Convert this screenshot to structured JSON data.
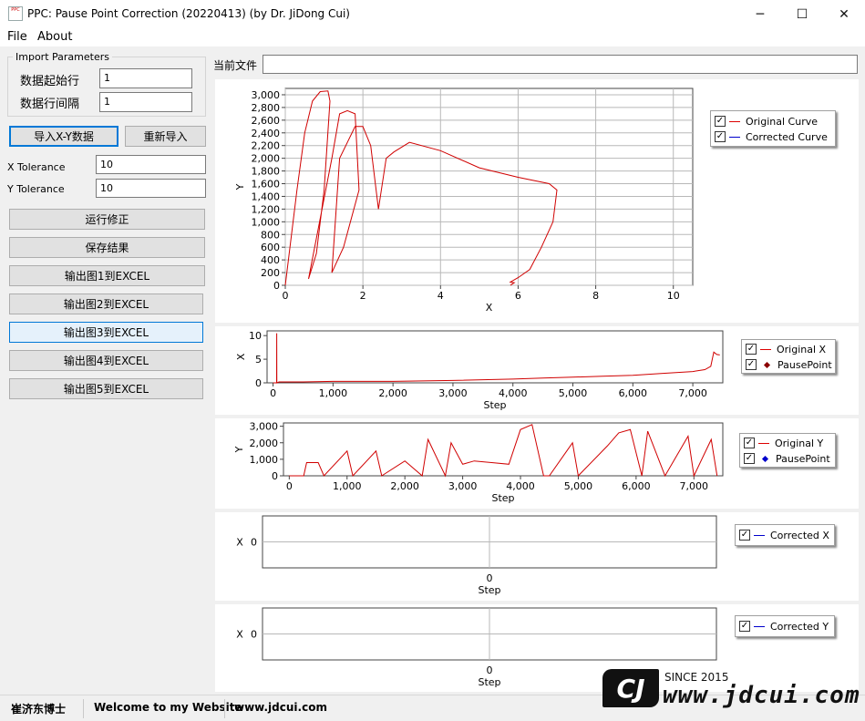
{
  "window": {
    "title": "PPC: Pause Point Correction (20220413) (by Dr. JiDong Cui)",
    "icon_text": "PPC",
    "controls": [
      "─",
      "☐",
      "✕"
    ]
  },
  "menu": {
    "items": [
      "File",
      "About"
    ]
  },
  "import_params": {
    "legend": "Import Parameters",
    "start_row_label": "数据起始行",
    "start_row_value": "1",
    "row_interval_label": "数据行间隔",
    "row_interval_value": "1"
  },
  "buttons": {
    "import_xy": "导入X-Y数据",
    "reimport": "重新导入",
    "run": "运行修正",
    "save": "保存结果",
    "export1": "输出图1到EXCEL",
    "export2": "输出图2到EXCEL",
    "export3": "输出图3到EXCEL",
    "export4": "输出图4到EXCEL",
    "export5": "输出图5到EXCEL"
  },
  "tolerance": {
    "x_label": "X Tolerance",
    "x_value": "10",
    "y_label": "Y Tolerance",
    "y_value": "10"
  },
  "current_file": {
    "label": "当前文件",
    "value": ""
  },
  "colors": {
    "original": "#d00000",
    "corrected": "#0000cc",
    "pause_original_x": "#8b0000",
    "pause_original_y": "#0000cc",
    "focus": "#0078d7"
  },
  "charts": {
    "xy": {
      "xlabel": "X",
      "ylabel": "Y",
      "x_ticks": [
        "0",
        "2",
        "4",
        "6",
        "8",
        "10"
      ],
      "y_ticks": [
        "0",
        "200",
        "400",
        "600",
        "800",
        "1,000",
        "1,200",
        "1,400",
        "1,600",
        "1,800",
        "2,000",
        "2,200",
        "2,400",
        "2,600",
        "2,800",
        "3,000"
      ],
      "legend": [
        "Original Curve",
        "Corrected Curve"
      ]
    },
    "step_x": {
      "xlabel": "Step",
      "ylabel": "X",
      "x_ticks": [
        "0",
        "1,000",
        "2,000",
        "3,000",
        "4,000",
        "5,000",
        "6,000",
        "7,000"
      ],
      "y_ticks": [
        "0",
        "5",
        "10"
      ],
      "legend": [
        "Original X",
        "PausePoint"
      ]
    },
    "step_y": {
      "xlabel": "Step",
      "ylabel": "Y",
      "x_ticks": [
        "0",
        "1,000",
        "2,000",
        "3,000",
        "4,000",
        "5,000",
        "6,000",
        "7,000"
      ],
      "y_ticks": [
        "0",
        "1,000",
        "2,000",
        "3,000"
      ],
      "legend": [
        "Original Y",
        "PausePoint"
      ]
    },
    "corr_x": {
      "xlabel": "Step",
      "ylabel": "X",
      "x_tick": "0",
      "y_tick": "0",
      "legend": [
        "Corrected X"
      ]
    },
    "corr_y": {
      "xlabel": "Step",
      "ylabel": "X",
      "x_tick": "0",
      "y_tick": "0",
      "legend": [
        "Corrected Y"
      ]
    }
  },
  "chart_data": [
    {
      "type": "line",
      "title": "",
      "xlabel": "X",
      "ylabel": "Y",
      "xlim": [
        0,
        10.5
      ],
      "ylim": [
        0,
        3100
      ],
      "grid": true,
      "legend_placement": "right",
      "series": [
        {
          "name": "Original Curve",
          "x": [
            0,
            0.3,
            0.5,
            0.7,
            0.9,
            1.1,
            1.15,
            1.0,
            0.8,
            0.6,
            1.2,
            1.4,
            1.6,
            1.8,
            1.9,
            1.5,
            1.2,
            1.4,
            1.8,
            2.0,
            2.2,
            2.4,
            2.6,
            2.8,
            3.2,
            4.0,
            5.0,
            6.0,
            6.8,
            7.0,
            6.9,
            6.6,
            6.3,
            6.0,
            5.8,
            5.9,
            5.8
          ],
          "y": [
            0,
            1500,
            2400,
            2900,
            3050,
            3060,
            2900,
            1500,
            500,
            100,
            2000,
            2700,
            2750,
            2700,
            1500,
            600,
            200,
            2000,
            2500,
            2500,
            2200,
            1200,
            2000,
            2100,
            2250,
            2120,
            1850,
            1700,
            1600,
            1500,
            1000,
            600,
            250,
            120,
            50,
            40,
            0
          ]
        },
        {
          "name": "Corrected Curve",
          "x": [],
          "y": []
        }
      ]
    },
    {
      "type": "line",
      "title": "",
      "xlabel": "Step",
      "ylabel": "X",
      "xlim": [
        -100,
        7500
      ],
      "ylim": [
        0,
        11
      ],
      "grid": false,
      "legend_placement": "right",
      "series": [
        {
          "name": "Original X",
          "x": [
            0,
            60,
            61,
            62,
            100,
            500,
            1000,
            2000,
            3000,
            4000,
            4500,
            5000,
            5500,
            6000,
            6500,
            7000,
            7200,
            7300,
            7350,
            7400,
            7450
          ],
          "y": [
            0,
            0,
            10.5,
            0,
            0.2,
            0.2,
            0.3,
            0.3,
            0.5,
            0.8,
            1.0,
            1.2,
            1.4,
            1.6,
            2.0,
            2.4,
            2.8,
            3.5,
            6.5,
            6.0,
            5.9
          ]
        },
        {
          "name": "PausePoint",
          "x": [],
          "y": []
        }
      ]
    },
    {
      "type": "line",
      "title": "",
      "xlabel": "Step",
      "ylabel": "Y",
      "xlim": [
        -100,
        7500
      ],
      "ylim": [
        0,
        3200
      ],
      "grid": false,
      "legend_placement": "right",
      "series": [
        {
          "name": "Original Y",
          "x": [
            0,
            250,
            300,
            500,
            600,
            1000,
            1100,
            1500,
            1600,
            2000,
            2300,
            2400,
            2700,
            2800,
            3000,
            3200,
            3500,
            3800,
            4000,
            4200,
            4400,
            4500,
            4900,
            5000,
            5500,
            5700,
            5900,
            6100,
            6200,
            6500,
            6900,
            7000,
            7300,
            7400
          ],
          "y": [
            0,
            0,
            800,
            800,
            0,
            1500,
            0,
            1500,
            0,
            900,
            0,
            2200,
            0,
            2000,
            700,
            900,
            800,
            700,
            2800,
            3100,
            0,
            0,
            2000,
            0,
            1800,
            2600,
            2800,
            0,
            2700,
            0,
            2400,
            0,
            2200,
            0
          ]
        },
        {
          "name": "PausePoint",
          "x": [],
          "y": []
        }
      ]
    },
    {
      "type": "line",
      "title": "",
      "xlabel": "Step",
      "ylabel": "X",
      "series": [
        {
          "name": "Corrected X",
          "x": [],
          "y": []
        }
      ]
    },
    {
      "type": "line",
      "title": "",
      "xlabel": "Step",
      "ylabel": "X",
      "series": [
        {
          "name": "Corrected Y",
          "x": [],
          "y": []
        }
      ]
    }
  ],
  "status": {
    "author": "崔济东博士",
    "welcome": "Welcome to my Website",
    "site": "www.jdcui.com",
    "since": "SINCE 2015",
    "logo": "www.jdcui.com",
    "logo_mark": "CJ"
  }
}
